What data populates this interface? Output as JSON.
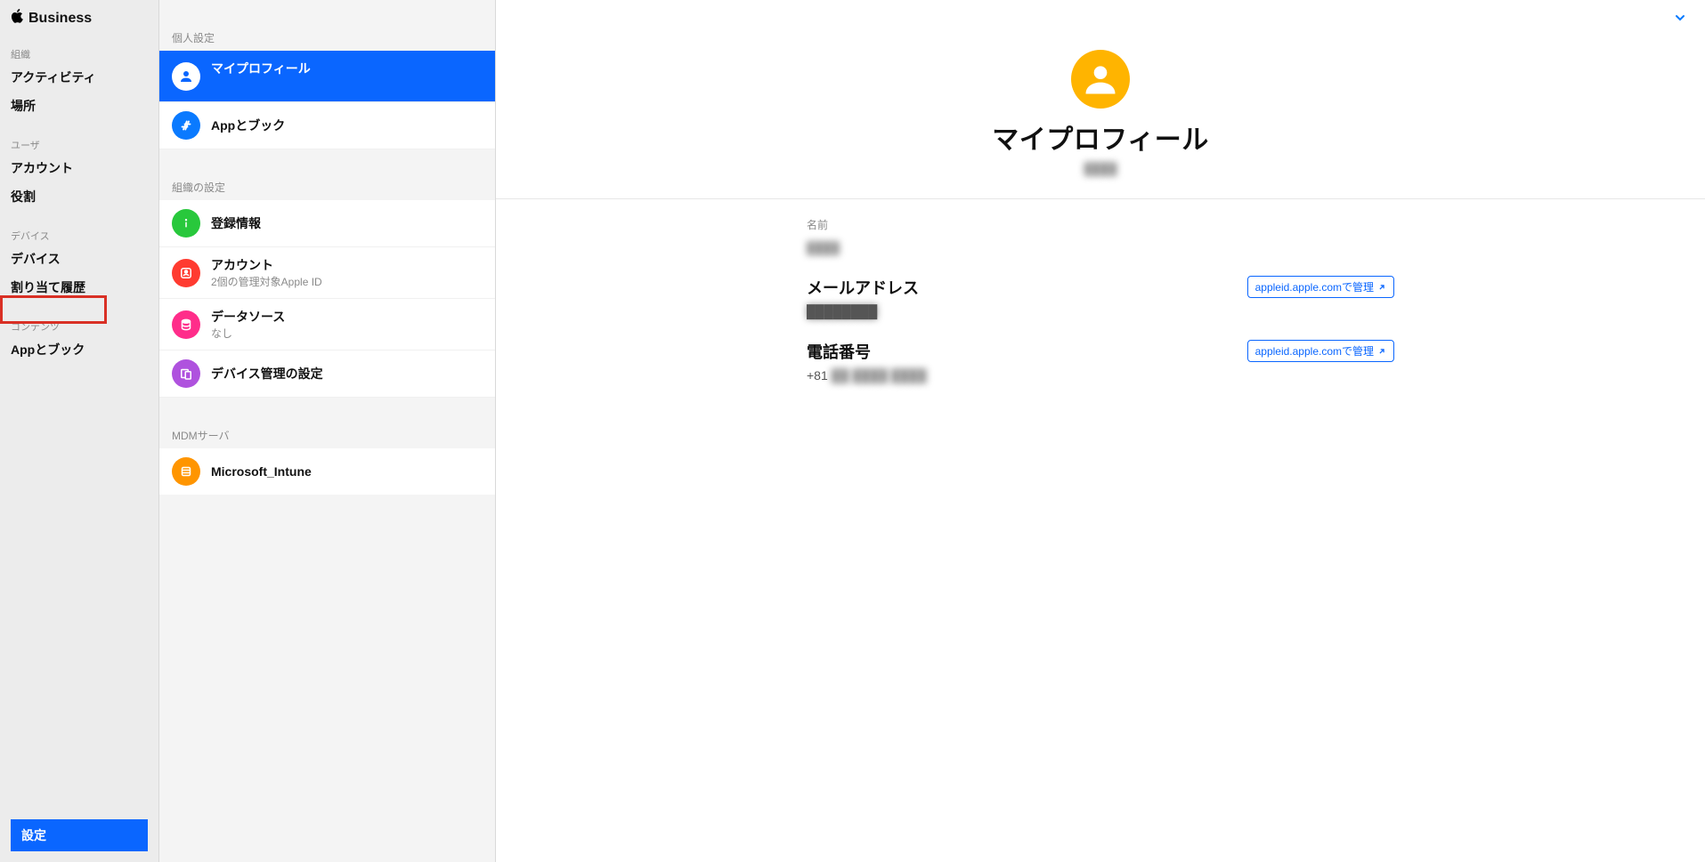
{
  "brand": "Business",
  "sidebar": {
    "groups": [
      {
        "label": "組織",
        "items": [
          "アクティビティ",
          "場所"
        ]
      },
      {
        "label": "ユーザ",
        "items": [
          "アカウント",
          "役割"
        ]
      },
      {
        "label": "デバイス",
        "items": [
          "デバイス",
          "割り当て履歴"
        ]
      },
      {
        "label": "コンテンツ",
        "items": [
          "Appとブック"
        ]
      }
    ],
    "settings": "設定"
  },
  "midcol": {
    "sections": [
      {
        "label": "個人設定",
        "items": [
          {
            "title": "マイプロフィール",
            "sub": "　",
            "icon": "person",
            "color": "white",
            "selected": true
          },
          {
            "title": "Appとブック",
            "sub": "",
            "icon": "appstore",
            "color": "blue"
          }
        ]
      },
      {
        "label": "組織の設定",
        "items": [
          {
            "title": "登録情報",
            "sub": "",
            "icon": "info",
            "color": "green"
          },
          {
            "title": "アカウント",
            "sub": "2個の管理対象Apple ID",
            "icon": "person-box",
            "color": "red"
          },
          {
            "title": "データソース",
            "sub": "なし",
            "icon": "db",
            "color": "magenta"
          },
          {
            "title": "デバイス管理の設定",
            "sub": "",
            "icon": "devices",
            "color": "purple"
          }
        ]
      },
      {
        "label": "MDMサーバ",
        "items": [
          {
            "title": "Microsoft_Intune",
            "sub": "",
            "icon": "server",
            "color": "orange"
          }
        ]
      }
    ]
  },
  "main": {
    "title": "マイプロフィール",
    "subtitle_redacted": "████",
    "name_label": "名前",
    "name_value_redacted": "████",
    "email_label": "メールアドレス",
    "email_value_redacted": "████████",
    "phone_label": "電話番号",
    "phone_value": "+81",
    "phone_rest_redacted": "██ ████ ████",
    "manage_link": "appleid.apple.comで管理"
  }
}
